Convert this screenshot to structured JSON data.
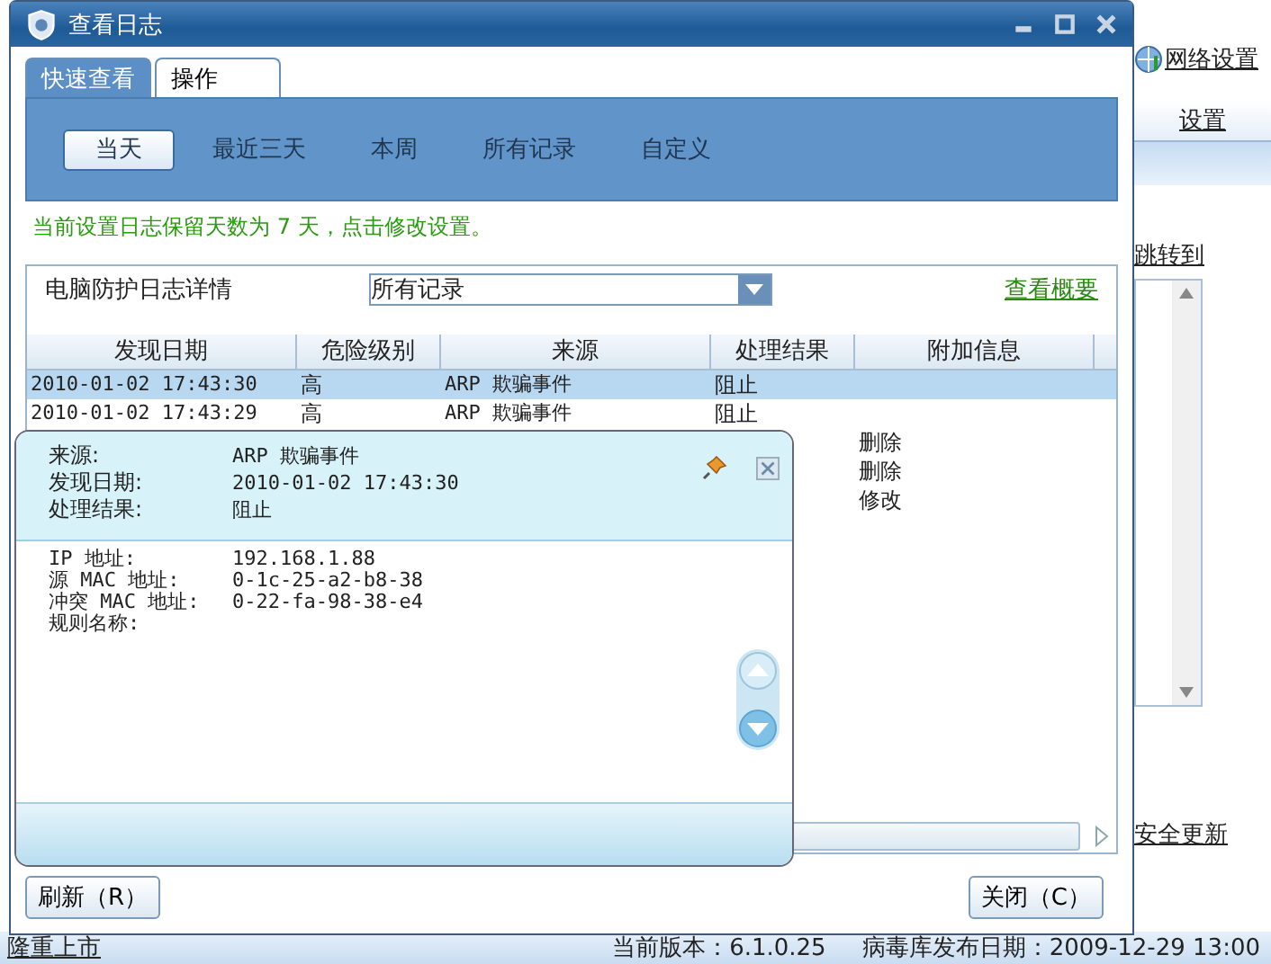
{
  "background_app": {
    "network_link": "网络设置",
    "settings_tab": "设置",
    "jump_link": "跳转到",
    "update_link": "安全更新",
    "status_bar": {
      "promo_link": "隆重上市",
      "version": "当前版本：6.1.0.25",
      "virus_db_date": "病毒库发布日期：2009-12-29 13:00"
    }
  },
  "window": {
    "title": "查看日志"
  },
  "tabs": [
    {
      "label": "快速查看",
      "selected": true
    },
    {
      "label": "操作",
      "selected": false
    }
  ],
  "ranges": [
    {
      "label": "当天",
      "selected": true
    },
    {
      "label": "最近三天",
      "selected": false
    },
    {
      "label": "本周",
      "selected": false
    },
    {
      "label": "所有记录",
      "selected": false
    },
    {
      "label": "自定义",
      "selected": false
    }
  ],
  "retention_notice": "当前设置日志保留天数为 7 天，点击修改设置。",
  "log_panel": {
    "label": "电脑防护日志详情",
    "filter": "所有记录",
    "overview_link": "查看概要"
  },
  "table": {
    "columns": [
      "发现日期",
      "危险级别",
      "来源",
      "处理结果",
      "附加信息"
    ],
    "rows": [
      {
        "date": "2010-01-02 17:43:30",
        "level": "高",
        "source": "ARP 欺骗事件",
        "result": "阻止",
        "selected": true
      },
      {
        "date": "2010-01-02 17:43:29",
        "level": "高",
        "source": "ARP 欺骗事件",
        "result": "阻止",
        "selected": false
      },
      {
        "extra": "删除",
        "selected": false
      },
      {
        "extra": "删除",
        "selected": false
      },
      {
        "extra": "修改",
        "selected": false
      }
    ]
  },
  "detail_popup": {
    "summary": [
      {
        "label": "来源:",
        "value": "ARP 欺骗事件"
      },
      {
        "label": "发现日期:",
        "value": "2010-01-02 17:43:30"
      },
      {
        "label": "处理结果:",
        "value": "阻止"
      }
    ],
    "details": [
      {
        "label": "IP 地址:",
        "value": "192.168.1.88"
      },
      {
        "label": "源 MAC 地址:",
        "value": "0-1c-25-a2-b8-38"
      },
      {
        "label": "冲突 MAC 地址:",
        "value": "0-22-fa-98-38-e4"
      },
      {
        "label": "规则名称:"
      }
    ]
  },
  "buttons": {
    "refresh": "刷新（R）",
    "close": "关闭（C）"
  }
}
